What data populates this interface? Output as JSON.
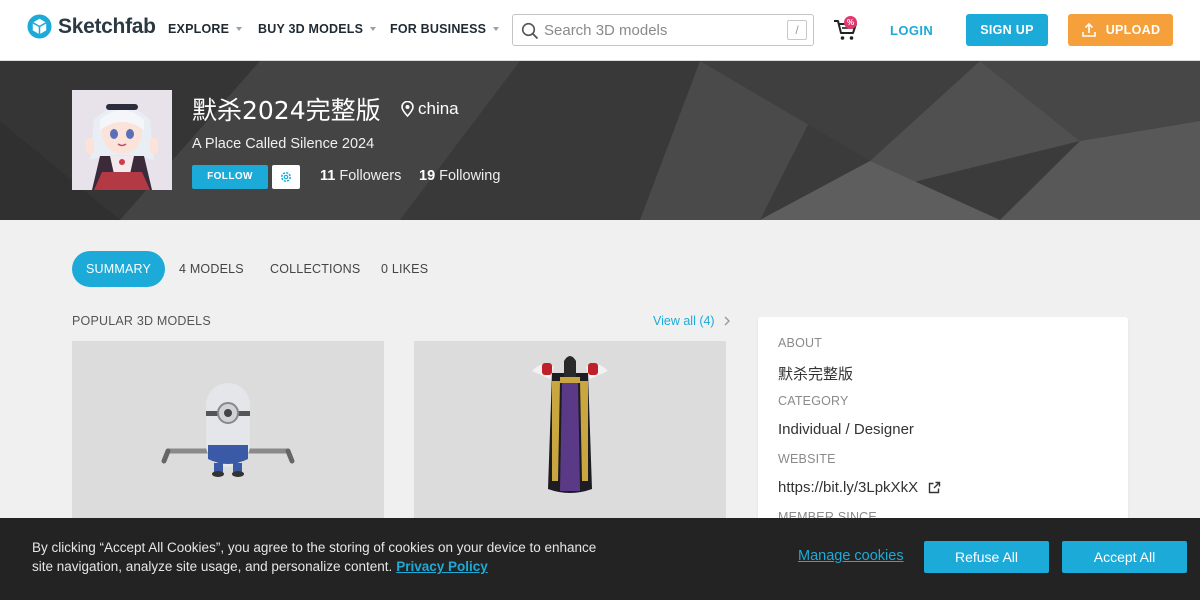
{
  "header": {
    "logo_text": "Sketchfab",
    "nav": [
      {
        "label": "EXPLORE"
      },
      {
        "label": "BUY 3D MODELS"
      },
      {
        "label": "FOR BUSINESS"
      }
    ],
    "search": {
      "placeholder": "Search 3D models",
      "shortcut": "/"
    },
    "cart_badge": "%",
    "login": "LOGIN",
    "signup": "SIGN UP",
    "upload": "UPLOAD",
    "colors": {
      "accent": "#1caad9",
      "upload": "#f5a03a",
      "badge": "#e0386e"
    }
  },
  "profile": {
    "name": "默杀2024完整版",
    "location": "china",
    "tagline": "A Place Called Silence 2024",
    "follow_label": "FOLLOW",
    "followers_count": "11",
    "followers_label": "Followers",
    "following_count": "19",
    "following_label": "Following"
  },
  "tabs": [
    {
      "label": "SUMMARY",
      "active": true
    },
    {
      "label": "4 MODELS",
      "active": false
    },
    {
      "label": "COLLECTIONS",
      "active": false
    },
    {
      "label": "0 LIKES",
      "active": false
    }
  ],
  "popular": {
    "title": "POPULAR 3D MODELS",
    "view_all": "View all (4)"
  },
  "about": {
    "about_label": "ABOUT",
    "about_value": "默杀完整版",
    "category_label": "CATEGORY",
    "category_value": "Individual / Designer",
    "website_label": "WEBSITE",
    "website_value": "https://bit.ly/3LpkXkX",
    "member_since_label": "MEMBER SINCE"
  },
  "cookie": {
    "text": "By clicking “Accept All Cookies”, you agree to the storing of cookies on your device to enhance site navigation, analyze site usage, and personalize content.",
    "privacy_label": "Privacy Policy",
    "manage_label": "Manage cookies",
    "refuse_label": "Refuse All",
    "accept_label": "Accept All"
  }
}
